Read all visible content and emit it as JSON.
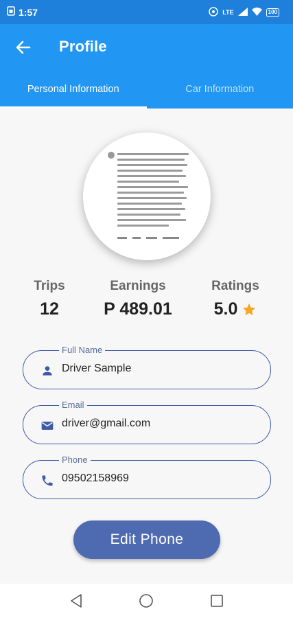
{
  "status_bar": {
    "time": "1:57",
    "network": "LTE",
    "battery": "100"
  },
  "app_bar": {
    "title": "Profile"
  },
  "tabs": [
    {
      "label": "Personal Information",
      "active": true
    },
    {
      "label": "Car Information",
      "active": false
    }
  ],
  "stats": {
    "trips": {
      "label": "Trips",
      "value": "12"
    },
    "earnings": {
      "label": "Earnings",
      "value": "P 489.01"
    },
    "ratings": {
      "label": "Ratings",
      "value": "5.0"
    }
  },
  "fields": {
    "full_name": {
      "label": "Full Name",
      "value": "Driver Sample",
      "icon": "person-icon"
    },
    "email": {
      "label": "Email",
      "value": "driver@gmail.com",
      "icon": "mail-icon"
    },
    "phone": {
      "label": "Phone",
      "value": "09502158969",
      "icon": "phone-icon"
    }
  },
  "edit_button": {
    "label": "Edit Phone"
  },
  "colors": {
    "status_bar": "#1f80dc",
    "app_bar": "#2196f3",
    "accent": "#3d5aa8",
    "button": "#4e6ab0",
    "star": "#f5a623"
  },
  "nav": [
    "back-triangle-icon",
    "home-circle-icon",
    "recents-square-icon"
  ]
}
